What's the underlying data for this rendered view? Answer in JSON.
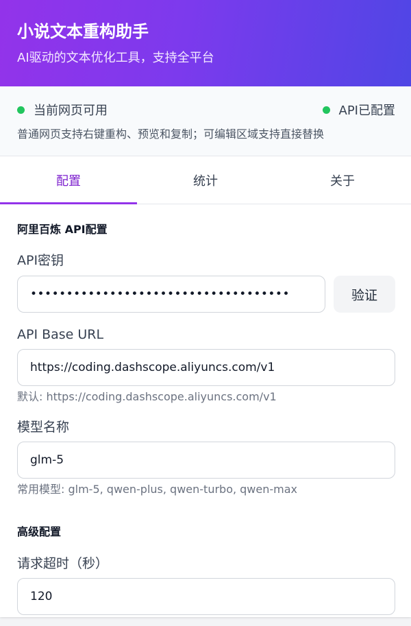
{
  "header": {
    "title": "小说文本重构助手",
    "subtitle": "AI驱动的文本优化工具，支持全平台"
  },
  "status": {
    "page_status": "当前网页可用",
    "api_status": "API已配置",
    "note": "普通网页支持右键重构、预览和复制；可编辑区域支持直接替换",
    "dot_color": "#22c55e"
  },
  "tabs": [
    {
      "label": "配置",
      "active": true
    },
    {
      "label": "统计",
      "active": false
    },
    {
      "label": "关于",
      "active": false
    }
  ],
  "config": {
    "section_title": "阿里百炼 API配置",
    "api_key": {
      "label": "API密钥",
      "value": "••••••••••••••••••••••••••••••••••••",
      "verify_label": "验证"
    },
    "base_url": {
      "label": "API Base URL",
      "value": "https://coding.dashscope.aliyuncs.com/v1",
      "hint": "默认: https://coding.dashscope.aliyuncs.com/v1"
    },
    "model": {
      "label": "模型名称",
      "value": "glm-5",
      "hint": "常用模型: glm-5, qwen-plus, qwen-turbo, qwen-max"
    }
  },
  "advanced": {
    "section_title": "高级配置",
    "timeout": {
      "label": "请求超时（秒）",
      "value": "120"
    }
  },
  "colors": {
    "accent": "#9333ea",
    "gradient_end": "#4f46e5"
  }
}
